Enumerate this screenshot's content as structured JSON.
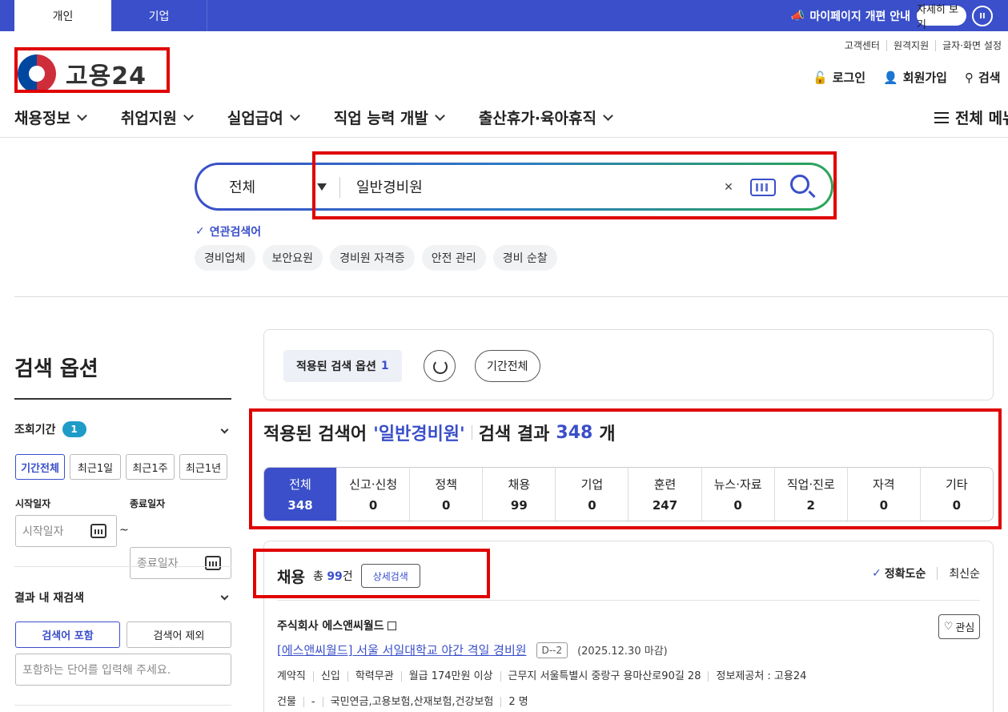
{
  "topbar": {
    "tabs": [
      "개인",
      "기업"
    ],
    "notice": "마이페이지 개편 안내",
    "detail_button": "자세히 보기",
    "pause_icon": "pause-icon"
  },
  "header": {
    "logo_text": "고용24",
    "util_links": [
      "고객센터",
      "원격지원",
      "글자·화면 설정"
    ],
    "auth_links": {
      "login": "로그인",
      "signup": "회원가입",
      "search": "검색"
    },
    "all_menu": "전체 메뉴"
  },
  "nav": {
    "items": [
      "채용정보",
      "취업지원",
      "실업급여",
      "직업 능력 개발",
      "출산휴가·육아휴직"
    ]
  },
  "search": {
    "scope": "전체",
    "query": "일반경비원",
    "related_title": "연관검색어",
    "related": [
      "경비업체",
      "보안요원",
      "경비원 자격증",
      "안전 관리",
      "경비 순찰"
    ]
  },
  "options": {
    "title": "검색 옵션",
    "period": {
      "label": "조회기간",
      "badge": "1",
      "buttons": [
        "기간전체",
        "최근1일",
        "최근1주",
        "최근1년"
      ],
      "start_label": "시작일자",
      "end_label": "종료일자",
      "start_placeholder": "시작일자",
      "end_placeholder": "종료일자",
      "tilde": "~"
    },
    "research": {
      "label": "결과 내 재검색",
      "include": "검색어 포함",
      "exclude": "검색어 제외",
      "placeholder": "포함하는 단어를 입력해 주세요."
    }
  },
  "applied": {
    "label": "적용된 검색 옵션",
    "count": "1",
    "period": "기간전체"
  },
  "result": {
    "prefix": "적용된 검색어",
    "keyword": "'일반경비원'",
    "label": "검색 결과",
    "count": "348",
    "unit": "개"
  },
  "categories": [
    {
      "label": "전체",
      "count": "348"
    },
    {
      "label": "신고·신청",
      "count": "0"
    },
    {
      "label": "정책",
      "count": "0"
    },
    {
      "label": "채용",
      "count": "99"
    },
    {
      "label": "기업",
      "count": "0"
    },
    {
      "label": "훈련",
      "count": "247"
    },
    {
      "label": "뉴스·자료",
      "count": "0"
    },
    {
      "label": "직업·진로",
      "count": "2"
    },
    {
      "label": "자격",
      "count": "0"
    },
    {
      "label": "기타",
      "count": "0"
    }
  ],
  "jobs": {
    "title": "채용",
    "total_prefix": "총",
    "total": "99",
    "total_unit": "건",
    "detail_search": "상세검색",
    "sort_accuracy": "정확도순",
    "sort_latest": "최신순",
    "item": {
      "company": "주식회사 에스앤씨월드",
      "favorite": "관심",
      "title": "[에스앤씨월드] 서울 서일대학교 야간 격일 경비원",
      "dday": "D--2",
      "deadline": "(2025.12.30 마감)",
      "meta1": [
        "계약직",
        "신입",
        "학력무관",
        "월급 174만원 이상",
        "근무지 서울특별시 중랑구 용마산로90길 28",
        "정보제공처 : 고용24"
      ],
      "meta2": [
        "건물",
        "-",
        "국민연금,고용보험,산재보험,건강보험",
        "2 명"
      ]
    }
  },
  "colors": {
    "primary": "#3a4fc9",
    "highlight_box": "#e00000",
    "badge": "#1e9bc7",
    "gradient_end": "#2aa556"
  }
}
